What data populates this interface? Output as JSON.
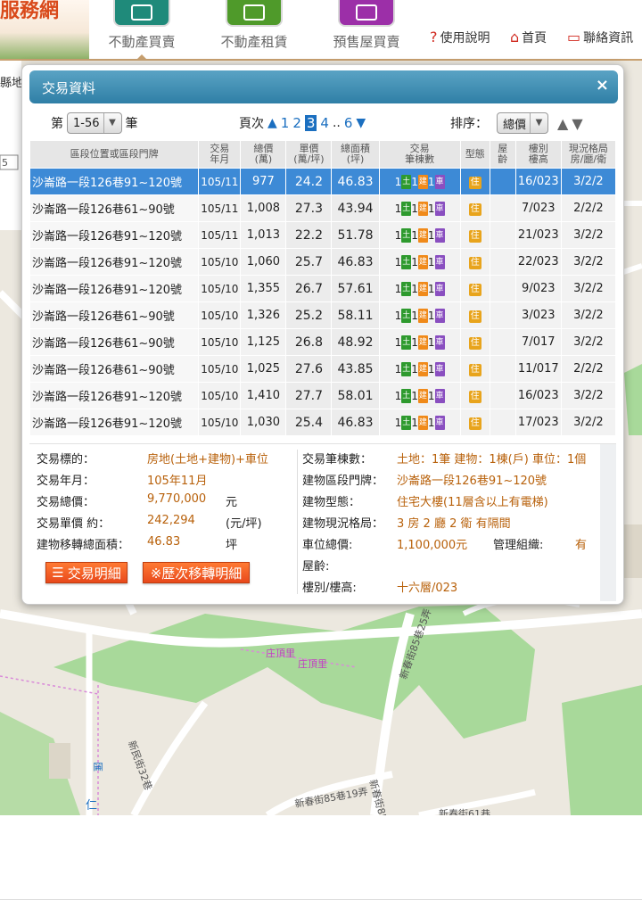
{
  "brand": {
    "text": "服務網"
  },
  "nav": {
    "tabs": [
      {
        "label": "不動產買賣",
        "color": "#1f8a7a"
      },
      {
        "label": "不動產租賃",
        "color": "#4f9a2a"
      },
      {
        "label": "預售屋買賣",
        "color": "#9c2fa8"
      }
    ],
    "help": "使用說明",
    "home": "首頁",
    "contact": "聯絡資訊"
  },
  "map": {
    "left_edge_label": "縣地",
    "left_edge_number": "5",
    "labels": [
      "新春街85巷25弄",
      "新民街32巷",
      "新春街85巷19弄",
      "新春街85",
      "新春街61巷",
      "仁",
      "庄頂里",
      "庄頂里",
      "匯"
    ]
  },
  "dialog": {
    "title": "交易資料",
    "close": "×",
    "count_prefix": "第",
    "count_range": "1-56",
    "count_suffix": "筆",
    "page_label": "頁次",
    "pages": [
      "1",
      "2",
      "3",
      "4",
      "..",
      "6"
    ],
    "current_page": "3",
    "sort_label": "排序：",
    "sort_value": "總價",
    "columns": [
      "區段位置或區段門牌",
      "交易\n年月",
      "總價\n(萬)",
      "單價\n(萬/坪)",
      "總面積\n(坪)",
      "交易\n筆棟數",
      "型態",
      "屋\n齡",
      "樓別\n樓高",
      "現況格局\n房/廳/衛"
    ],
    "badge_labels": {
      "land": "土",
      "building": "建",
      "parking": "車",
      "residential": "住"
    },
    "rows": [
      {
        "address": "沙崙路一段126巷91~120號",
        "date": "105/11",
        "total": "977",
        "unit": "24.2",
        "area": "46.83",
        "land": "1",
        "bldg": "1",
        "park": "1",
        "floor": "16/023",
        "layout": "3/2/2",
        "selected": true
      },
      {
        "address": "沙崙路一段126巷61~90號",
        "date": "105/11",
        "total": "1,008",
        "unit": "27.3",
        "area": "43.94",
        "land": "1",
        "bldg": "1",
        "park": "1",
        "floor": "7/023",
        "layout": "2/2/2"
      },
      {
        "address": "沙崙路一段126巷91~120號",
        "date": "105/11",
        "total": "1,013",
        "unit": "22.2",
        "area": "51.78",
        "land": "1",
        "bldg": "1",
        "park": "1",
        "floor": "21/023",
        "layout": "3/2/2"
      },
      {
        "address": "沙崙路一段126巷91~120號",
        "date": "105/10",
        "total": "1,060",
        "unit": "25.7",
        "area": "46.83",
        "land": "1",
        "bldg": "1",
        "park": "1",
        "floor": "22/023",
        "layout": "3/2/2"
      },
      {
        "address": "沙崙路一段126巷91~120號",
        "date": "105/10",
        "total": "1,355",
        "unit": "26.7",
        "area": "57.61",
        "land": "1",
        "bldg": "1",
        "park": "1",
        "floor": "9/023",
        "layout": "3/2/2"
      },
      {
        "address": "沙崙路一段126巷61~90號",
        "date": "105/10",
        "total": "1,326",
        "unit": "25.2",
        "area": "58.11",
        "land": "1",
        "bldg": "1",
        "park": "1",
        "floor": "3/023",
        "layout": "3/2/2"
      },
      {
        "address": "沙崙路一段126巷61~90號",
        "date": "105/10",
        "total": "1,125",
        "unit": "26.8",
        "area": "48.92",
        "land": "1",
        "bldg": "1",
        "park": "1",
        "floor": "7/017",
        "layout": "3/2/2"
      },
      {
        "address": "沙崙路一段126巷61~90號",
        "date": "105/10",
        "total": "1,025",
        "unit": "27.6",
        "area": "43.85",
        "land": "1",
        "bldg": "1",
        "park": "1",
        "floor": "11/017",
        "layout": "2/2/2"
      },
      {
        "address": "沙崙路一段126巷91~120號",
        "date": "105/10",
        "total": "1,410",
        "unit": "27.7",
        "area": "58.01",
        "land": "1",
        "bldg": "1",
        "park": "1",
        "floor": "16/023",
        "layout": "3/2/2"
      },
      {
        "address": "沙崙路一段126巷91~120號",
        "date": "105/10",
        "total": "1,030",
        "unit": "25.4",
        "area": "46.83",
        "land": "1",
        "bldg": "1",
        "park": "1",
        "floor": "17/023",
        "layout": "3/2/2"
      }
    ],
    "detail": {
      "subject_label": "交易標的：",
      "subject_value": "房地(土地+建物)+車位",
      "date_label": "交易年月：",
      "date_value": "105年11月",
      "total_label": "交易總價：",
      "total_value": "9,770,000",
      "total_unit": "元",
      "unit_label": "交易單價 約：",
      "unit_value": "242,294",
      "unit_unit": "(元/坪)",
      "area_label": "建物移轉總面積：",
      "area_value": "46.83",
      "area_unit": "坪",
      "count_label": "交易筆棟數：",
      "count_value": "土地：1筆 建物：1棟(戶) 車位：1個",
      "address_label": "建物區段門牌：",
      "address_value": "沙崙路一段126巷91~120號",
      "type_label": "建物型態：",
      "type_value": "住宅大樓(11層含以上有電梯)",
      "layout_label": "建物現況格局：",
      "layout_value": "3 房 2 廳 2 衛 有隔間",
      "parking_label": "車位總價:",
      "parking_value": "1,100,000元",
      "mgmt_label": "管理組織:",
      "mgmt_value": "有",
      "age_label": "屋齡:",
      "floor_label": "樓別/樓高:",
      "floor_value": "十六層/023",
      "btn_detail": "交易明細",
      "btn_history": "※歷次移轉明細"
    }
  }
}
